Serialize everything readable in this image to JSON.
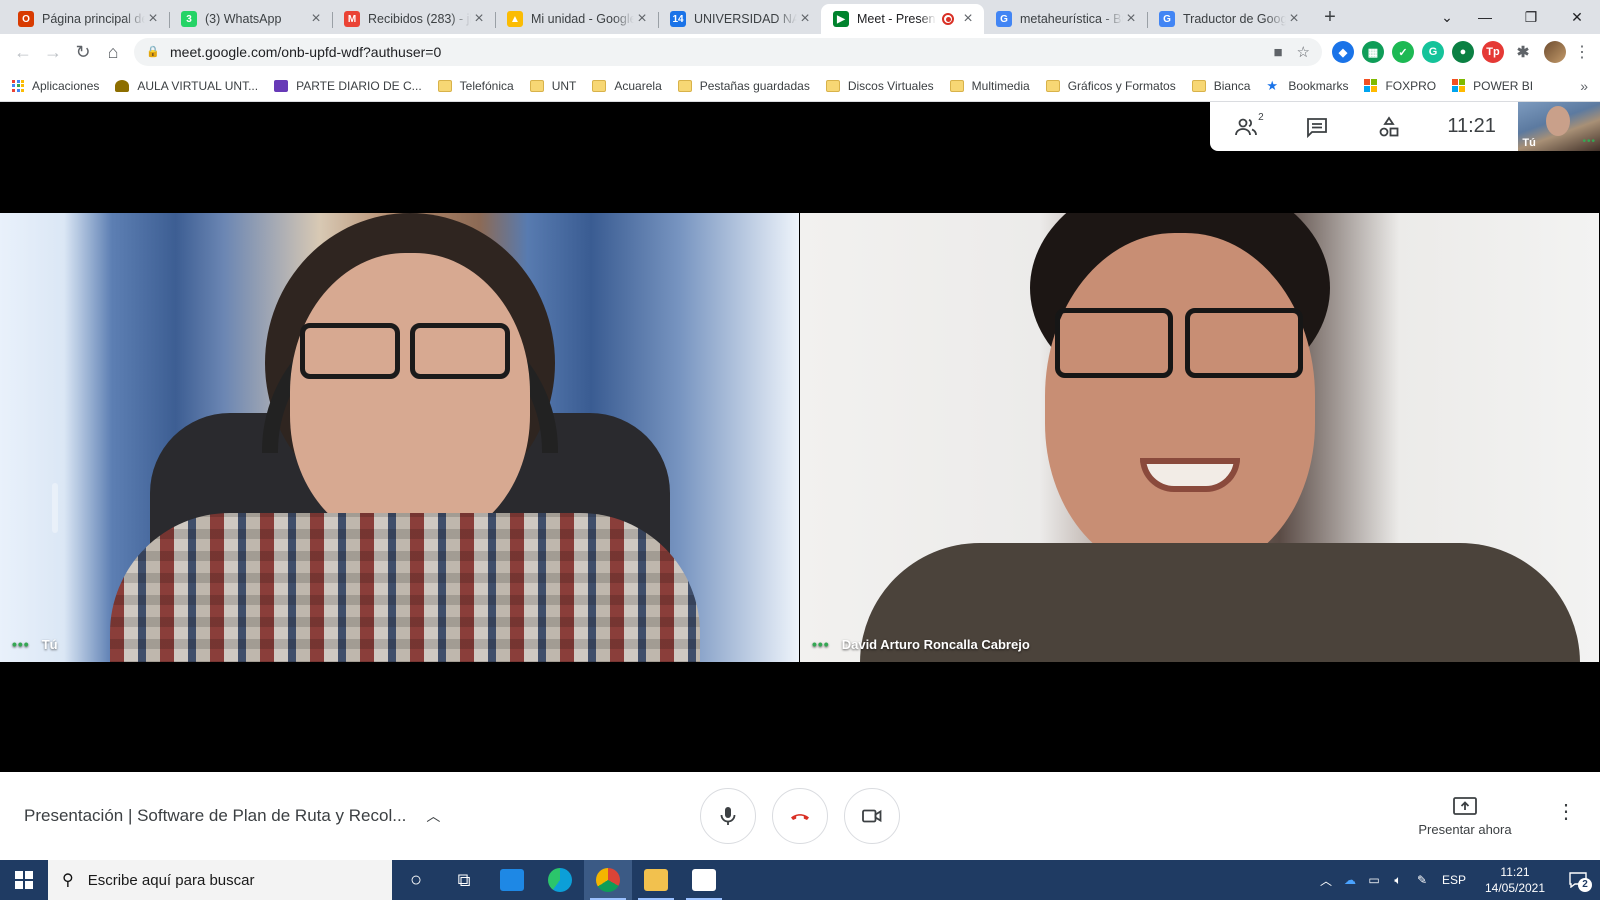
{
  "browser": {
    "tabs": [
      {
        "title": "Página principal de",
        "favicon_color": "#d83b01",
        "favicon_glyph": "O",
        "active": false
      },
      {
        "title": "(3) WhatsApp",
        "favicon_color": "#25d366",
        "favicon_glyph": "3",
        "active": false
      },
      {
        "title": "Recibidos (283) - jb",
        "favicon_color": "#ea4335",
        "favicon_glyph": "M",
        "active": false
      },
      {
        "title": "Mi unidad - Google",
        "favicon_color": "#fbbc04",
        "favicon_glyph": "▲",
        "active": false
      },
      {
        "title": "UNIVERSIDAD NAC",
        "favicon_color": "#1a73e8",
        "favicon_glyph": "14",
        "active": false
      },
      {
        "title": "Meet - Present",
        "favicon_color": "#00832d",
        "favicon_glyph": "▶",
        "active": true
      },
      {
        "title": "metaheurística - Bu",
        "favicon_color": "#4285f4",
        "favicon_glyph": "G",
        "active": false
      },
      {
        "title": "Traductor de Goog",
        "favicon_color": "#4285f4",
        "favicon_glyph": "G",
        "active": false
      }
    ],
    "url": "meet.google.com/onb-upfd-wdf?authuser=0",
    "extensions": [
      {
        "name": "shield-extension",
        "color": "#1a73e8",
        "glyph": "◆"
      },
      {
        "name": "sheets-extension",
        "color": "#0f9d58",
        "glyph": "▦"
      },
      {
        "name": "check-extension",
        "color": "#1db954",
        "glyph": "✓"
      },
      {
        "name": "grammarly-extension",
        "color": "#15c39a",
        "glyph": "G"
      },
      {
        "name": "location-extension",
        "color": "#0b8043",
        "glyph": "●"
      },
      {
        "name": "tp-extension",
        "color": "#e53935",
        "glyph": "Tp"
      }
    ]
  },
  "bookmarks": [
    {
      "label": "Aplicaciones",
      "icon": "apps"
    },
    {
      "label": "AULA VIRTUAL UNT...",
      "icon": "aula"
    },
    {
      "label": "PARTE DIARIO DE C...",
      "icon": "form"
    },
    {
      "label": "Telefónica",
      "icon": "folder"
    },
    {
      "label": "UNT",
      "icon": "folder"
    },
    {
      "label": "Acuarela",
      "icon": "folder"
    },
    {
      "label": "Pestañas guardadas",
      "icon": "folder"
    },
    {
      "label": "Discos Virtuales",
      "icon": "folder"
    },
    {
      "label": "Multimedia",
      "icon": "folder"
    },
    {
      "label": "Gráficos y Formatos",
      "icon": "folder"
    },
    {
      "label": "Bianca",
      "icon": "folder"
    },
    {
      "label": "Bookmarks",
      "icon": "star"
    },
    {
      "label": "FOXPRO",
      "icon": "ms"
    },
    {
      "label": "POWER BI",
      "icon": "ms"
    }
  ],
  "meet": {
    "participants_count": "2",
    "clock": "11:21",
    "self_thumb_label": "Tú",
    "tiles": [
      {
        "label": "Tú"
      },
      {
        "label": "David Arturo Roncalla Cabrejo"
      }
    ],
    "meeting_title": "Presentación | Software de Plan de Ruta y Recol...",
    "present_label": "Presentar ahora",
    "hangup_color": "#d93025"
  },
  "taskbar": {
    "search_placeholder": "Escribe aquí para buscar",
    "apps": [
      {
        "name": "cortana",
        "color": "",
        "running": false,
        "active": false
      },
      {
        "name": "task-view",
        "color": "",
        "running": false,
        "active": false
      },
      {
        "name": "calendar",
        "color": "#1e88e5",
        "running": false,
        "active": false
      },
      {
        "name": "edge",
        "color": "#0c9fd8",
        "running": false,
        "active": false
      },
      {
        "name": "chrome",
        "color": "#db4437",
        "running": true,
        "active": true
      },
      {
        "name": "file-explorer",
        "color": "#f2c14e",
        "running": true,
        "active": false
      },
      {
        "name": "notepad",
        "color": "#ffffff",
        "running": true,
        "active": false
      }
    ],
    "language": "ESP",
    "time": "11:21",
    "date": "14/05/2021",
    "notification_count": "2"
  }
}
